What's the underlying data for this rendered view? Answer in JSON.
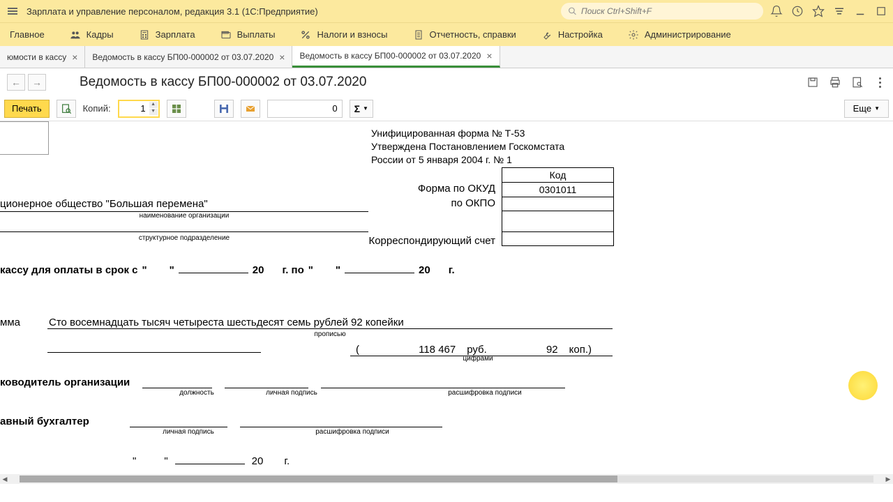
{
  "titlebar": {
    "title": "Зарплата и управление персоналом, редакция 3.1  (1С:Предприятие)",
    "search_placeholder": "Поиск Ctrl+Shift+F"
  },
  "nav": {
    "items": [
      {
        "label": "Главное"
      },
      {
        "label": "Кадры"
      },
      {
        "label": "Зарплата"
      },
      {
        "label": "Выплаты"
      },
      {
        "label": "Налоги и взносы"
      },
      {
        "label": "Отчетность, справки"
      },
      {
        "label": "Настройка"
      },
      {
        "label": "Администрирование"
      }
    ]
  },
  "tabs": {
    "items": [
      {
        "label": "юмости в кассу"
      },
      {
        "label": "Ведомость в кассу БП00-000002 от 03.07.2020"
      },
      {
        "label": "Ведомость в кассу БП00-000002 от 03.07.2020"
      }
    ]
  },
  "page": {
    "title": "Ведомость в кассу БП00-000002 от 03.07.2020"
  },
  "toolbar": {
    "print": "Печать",
    "copies_label": "Копий:",
    "copies_value": "1",
    "num_value": "0",
    "sigma": "Σ",
    "more": "Еще"
  },
  "form": {
    "header1": "Унифицированная форма № Т-53",
    "header2": "Утверждена Постановлением Госкомстата",
    "header3": "России от 5 января 2004 г. № 1",
    "codes": {
      "head": "Код",
      "okud": "0301011",
      "okpo": "",
      "blank": "",
      "acc": ""
    },
    "labels": {
      "okud": "Форма по ОКУД",
      "okpo": "по ОКПО",
      "acc": "Корреспондирующий счет"
    },
    "org": "ционерное общество \"Большая перемена\"",
    "org_sub": "наименование организации",
    "struct_sub": "структурное подразделение",
    "period_pref": "кассу для оплаты в срок с",
    "year": "20",
    "year_suf": "г. по",
    "year2": "20",
    "year2_suf": "г.",
    "sum_lbl": "мма",
    "sum_text": "Сто восемнадцать тысяч четыреста шестьдесят семь рублей 92 копейки",
    "sum_sub": "прописью",
    "sum_sub2": "цифрами",
    "sum_num_open": "(",
    "sum_num_val": "118 467",
    "sum_num_rub": "руб.",
    "sum_num_kop": "92",
    "sum_num_kop_lbl": "коп.)",
    "sig1": "ководитель организации",
    "sig1_sub1": "должность",
    "sig1_sub2": "личная подпись",
    "sig1_sub3": "расшифровка подписи",
    "sig2": "авный бухгалтер",
    "sig2_sub1": "личная подпись",
    "sig2_sub2": "расшифровка подписи",
    "date_year": "20",
    "date_suf": "г."
  }
}
